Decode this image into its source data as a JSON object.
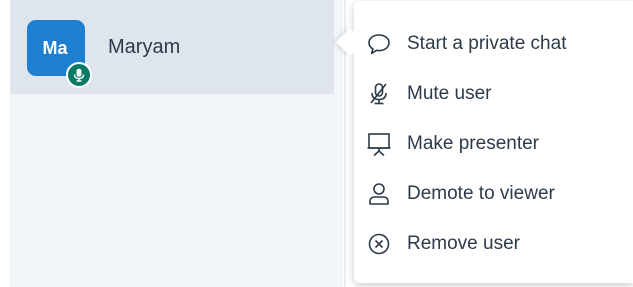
{
  "user": {
    "initials": "Ma",
    "name": "Maryam",
    "avatar_color": "#1e7fd0",
    "badge_color": "#0a7a67",
    "badge_icon": "microphone-icon"
  },
  "menu": {
    "items": [
      {
        "label": "Start a private chat",
        "icon": "chat-bubble-icon"
      },
      {
        "label": "Mute user",
        "icon": "microphone-muted-icon"
      },
      {
        "label": "Make presenter",
        "icon": "presentation-board-icon"
      },
      {
        "label": "Demote to viewer",
        "icon": "user-icon"
      },
      {
        "label": "Remove user",
        "icon": "circle-x-icon"
      }
    ]
  },
  "colors": {
    "list_background": "#f3f6f9",
    "selected_row": "#dfe5ed",
    "text": "#2d3a4a"
  }
}
